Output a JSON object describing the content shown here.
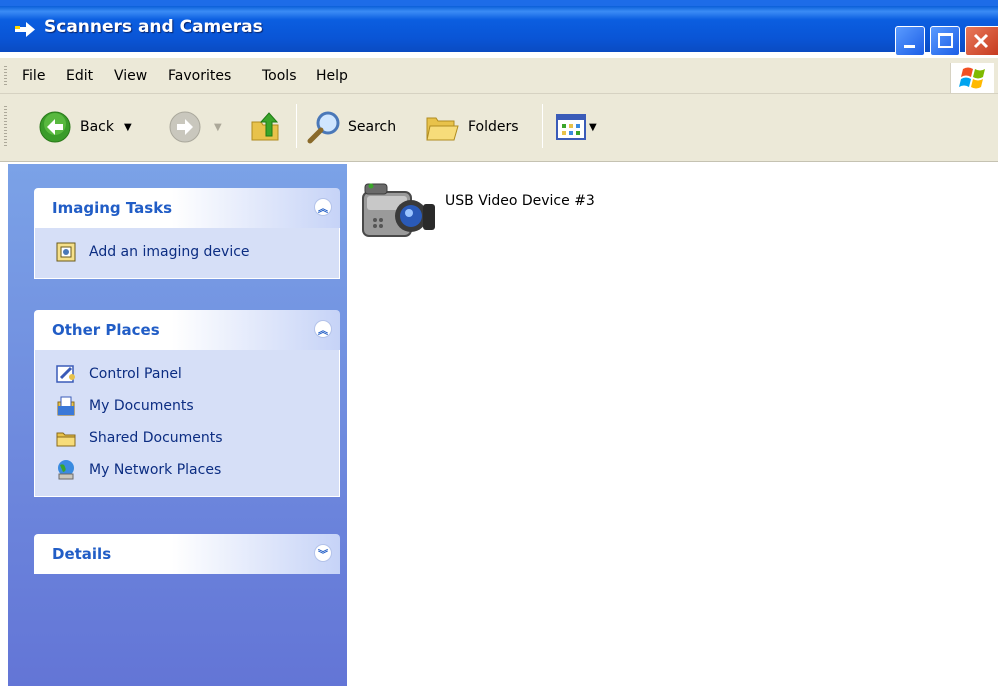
{
  "window": {
    "title": "Scanners and Cameras"
  },
  "menu": {
    "items": [
      "File",
      "Edit",
      "View",
      "Favorites",
      "Tools",
      "Help"
    ]
  },
  "toolbar": {
    "back_label": "Back",
    "search_label": "Search",
    "folders_label": "Folders"
  },
  "taskpane": {
    "imaging": {
      "title": "Imaging Tasks",
      "items": [
        "Add an imaging device"
      ]
    },
    "other": {
      "title": "Other Places",
      "items": [
        "Control Panel",
        "My Documents",
        "Shared Documents",
        "My Network Places"
      ]
    },
    "details": {
      "title": "Details"
    }
  },
  "content": {
    "items": [
      {
        "label": "USB Video Device #3",
        "icon": "camcorder-icon"
      }
    ]
  },
  "colors": {
    "titlebar": "#0a55d6",
    "taskpane": "#6f8ee0",
    "panel_title": "#215dc6",
    "link": "#0c2d82"
  }
}
